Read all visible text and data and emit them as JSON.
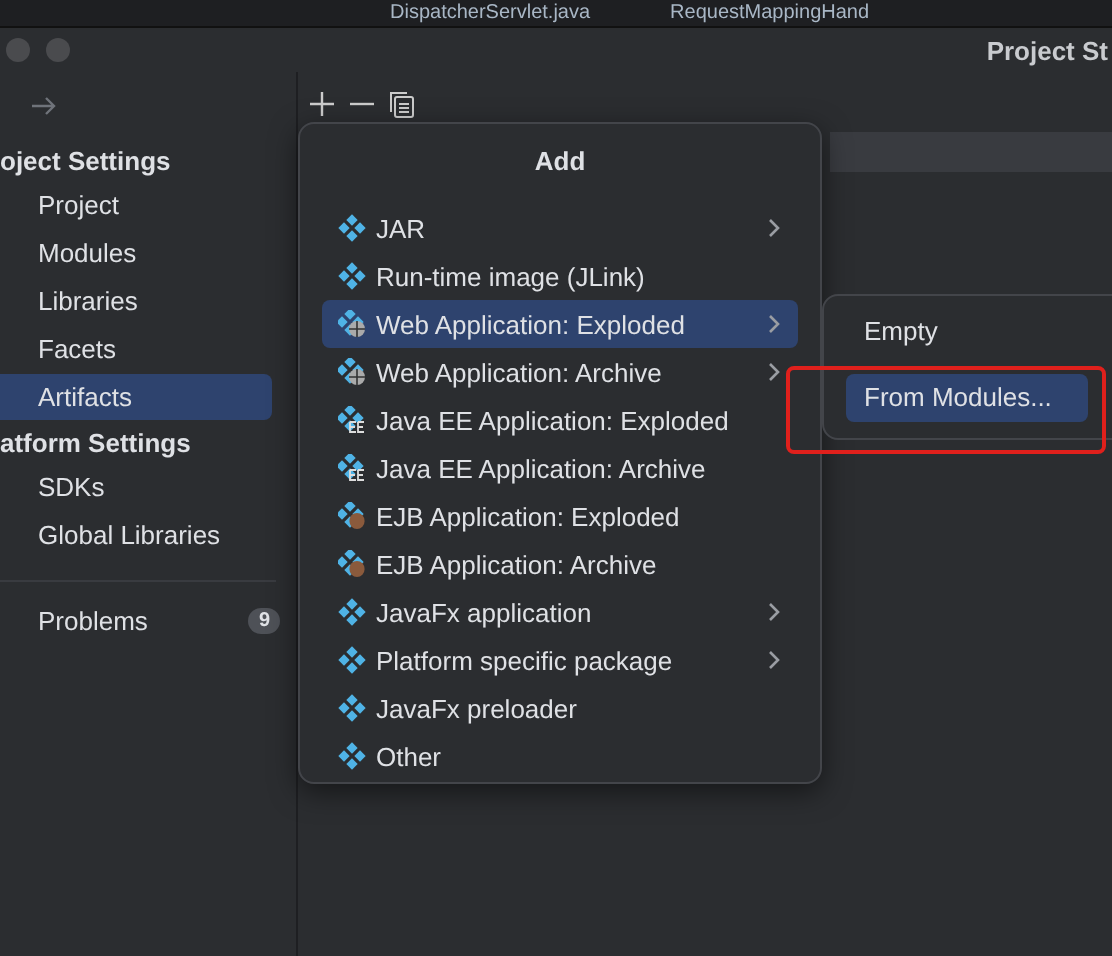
{
  "editor_tabs": [
    {
      "label": "DispatcherServlet.java"
    },
    {
      "label": "RequestMappingHand"
    }
  ],
  "window": {
    "title": "Project St"
  },
  "sidebar": {
    "groups": [
      {
        "heading": "oject Settings",
        "items": [
          {
            "label": "Project",
            "selected": false
          },
          {
            "label": "Modules",
            "selected": false
          },
          {
            "label": "Libraries",
            "selected": false
          },
          {
            "label": "Facets",
            "selected": false
          },
          {
            "label": "Artifacts",
            "selected": true
          }
        ]
      },
      {
        "heading": "atform Settings",
        "items": [
          {
            "label": "SDKs",
            "selected": false
          },
          {
            "label": "Global Libraries",
            "selected": false
          }
        ]
      }
    ],
    "problems": {
      "label": "Problems",
      "count": "9"
    }
  },
  "add_menu": {
    "title": "Add",
    "items": [
      {
        "label": "JAR",
        "kind": "module",
        "submenu": true,
        "selected": false
      },
      {
        "label": "Run-time image (JLink)",
        "kind": "module",
        "submenu": false,
        "selected": false
      },
      {
        "label": "Web Application: Exploded",
        "kind": "web",
        "submenu": true,
        "selected": true
      },
      {
        "label": "Web Application: Archive",
        "kind": "web",
        "submenu": true,
        "selected": false
      },
      {
        "label": "Java EE Application: Exploded",
        "kind": "ee",
        "submenu": false,
        "selected": false
      },
      {
        "label": "Java EE Application: Archive",
        "kind": "ee",
        "submenu": false,
        "selected": false
      },
      {
        "label": "EJB Application: Exploded",
        "kind": "ejb",
        "submenu": false,
        "selected": false
      },
      {
        "label": "EJB Application: Archive",
        "kind": "ejb",
        "submenu": false,
        "selected": false
      },
      {
        "label": "JavaFx application",
        "kind": "module",
        "submenu": true,
        "selected": false
      },
      {
        "label": "Platform specific package",
        "kind": "module",
        "submenu": true,
        "selected": false
      },
      {
        "label": "JavaFx preloader",
        "kind": "module",
        "submenu": false,
        "selected": false
      },
      {
        "label": "Other",
        "kind": "module",
        "submenu": false,
        "selected": false
      }
    ]
  },
  "submenu": {
    "items": [
      {
        "label": "Empty",
        "selected": false
      },
      {
        "label": "From Modules...",
        "selected": true
      }
    ]
  }
}
